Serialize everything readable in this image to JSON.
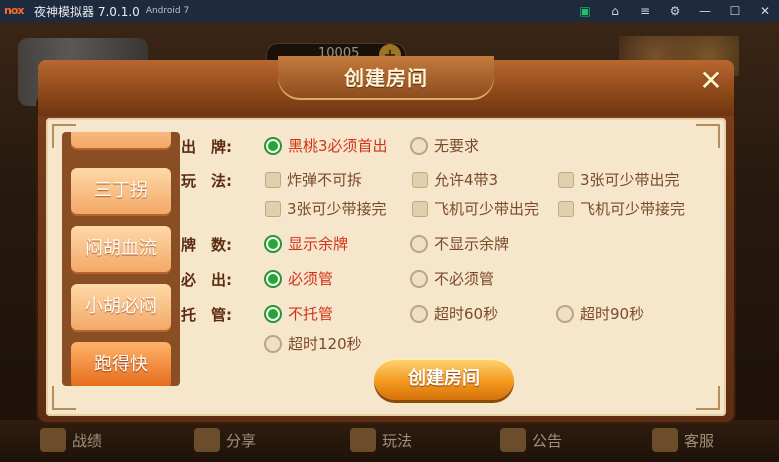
{
  "window": {
    "logo": "nox",
    "title": "夜神模拟器 7.0.1.0",
    "android_badge": "Android 7"
  },
  "toolbar_icons": [
    "store-icon",
    "shirt-icon",
    "menu-icon",
    "gear-icon",
    "minimize-icon",
    "maximize-icon",
    "close-icon"
  ],
  "background": {
    "coins": "10005",
    "plus": "+"
  },
  "dialog": {
    "title": "创建房间",
    "close": "✕",
    "tabs": [
      {
        "label": ""
      },
      {
        "label": "三丁拐"
      },
      {
        "label": "闷胡血流"
      },
      {
        "label": "小胡必闷"
      },
      {
        "label": "跑得快",
        "active": true
      }
    ],
    "rows": {
      "chupai": {
        "label": "出　牌:",
        "options": [
          {
            "label": "黑桃3必须首出",
            "selected": true
          },
          {
            "label": "无要求",
            "selected": false
          }
        ]
      },
      "wanfa": {
        "label": "玩　法:",
        "options": [
          {
            "label": "炸弹不可拆",
            "checked": false
          },
          {
            "label": "允许4带3",
            "checked": false
          },
          {
            "label": "3张可少带出完",
            "checked": false
          },
          {
            "label": "3张可少带接完",
            "checked": false
          },
          {
            "label": "飞机可少带出完",
            "checked": false
          },
          {
            "label": "飞机可少带接完",
            "checked": false
          }
        ]
      },
      "paishu": {
        "label": "牌　数:",
        "options": [
          {
            "label": "显示余牌",
            "selected": true
          },
          {
            "label": "不显示余牌",
            "selected": false
          }
        ]
      },
      "bichu": {
        "label": "必　出:",
        "options": [
          {
            "label": "必须管",
            "selected": true
          },
          {
            "label": "不必须管",
            "selected": false
          }
        ]
      },
      "tuoguan": {
        "label": "托　管:",
        "options": [
          {
            "label": "不托管",
            "selected": true
          },
          {
            "label": "超时60秒",
            "selected": false
          },
          {
            "label": "超时90秒",
            "selected": false
          },
          {
            "label": "超时120秒",
            "selected": false
          }
        ]
      }
    },
    "create_button": "创建房间"
  },
  "bottom_nav": [
    {
      "label": "战绩",
      "icon": "trophy-icon"
    },
    {
      "label": "分享",
      "icon": "share-icon"
    },
    {
      "label": "玩法",
      "icon": "rules-icon"
    },
    {
      "label": "公告",
      "icon": "mail-icon"
    },
    {
      "label": "客服",
      "icon": "service-icon"
    }
  ],
  "colors": {
    "selected_text": "#d0341c",
    "radio_on": "#2aa33a",
    "title_bar": "#1e2a3e"
  }
}
